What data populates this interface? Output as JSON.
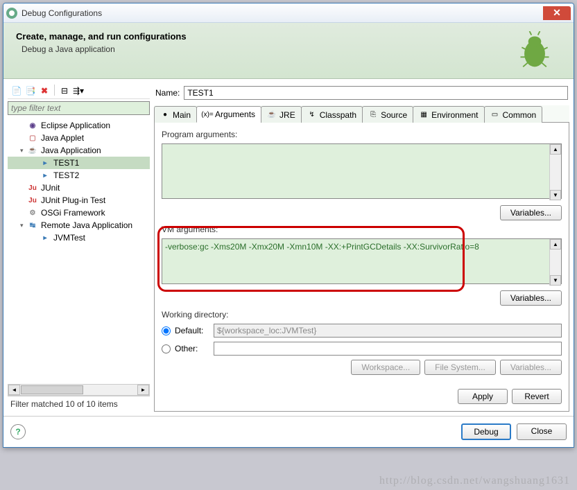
{
  "titlebar": {
    "text": "Debug Configurations"
  },
  "header": {
    "title": "Create, manage, and run configurations",
    "subtitle": "Debug a Java application"
  },
  "leftPane": {
    "filterPlaceholder": "type filter text",
    "tree": [
      {
        "label": "Eclipse Application",
        "icon": "eclipse",
        "indent": 1
      },
      {
        "label": "Java Applet",
        "icon": "applet",
        "indent": 1
      },
      {
        "label": "Java Application",
        "icon": "java-app",
        "indent": 1,
        "caret": "▾"
      },
      {
        "label": "TEST1",
        "icon": "java-run",
        "indent": 2,
        "selected": true
      },
      {
        "label": "TEST2",
        "icon": "java-run",
        "indent": 2
      },
      {
        "label": "JUnit",
        "icon": "junit",
        "indent": 1
      },
      {
        "label": "JUnit Plug-in Test",
        "icon": "junit-plug",
        "indent": 1
      },
      {
        "label": "OSGi Framework",
        "icon": "osgi",
        "indent": 1
      },
      {
        "label": "Remote Java Application",
        "icon": "remote",
        "indent": 1,
        "caret": "▾"
      },
      {
        "label": "JVMTest",
        "icon": "java-run",
        "indent": 2
      }
    ],
    "filterStatus": "Filter matched 10 of 10 items"
  },
  "rightPane": {
    "nameLabel": "Name:",
    "nameValue": "TEST1",
    "tabs": [
      {
        "label": "Main",
        "icon": "●"
      },
      {
        "label": "Arguments",
        "icon": "(x)=",
        "active": true
      },
      {
        "label": "JRE",
        "icon": "☕"
      },
      {
        "label": "Classpath",
        "icon": "↯"
      },
      {
        "label": "Source",
        "icon": "⎘"
      },
      {
        "label": "Environment",
        "icon": "▦"
      },
      {
        "label": "Common",
        "icon": "▭"
      }
    ],
    "programArgs": {
      "label": "Program arguments:",
      "value": "",
      "button": "Variables..."
    },
    "vmArgs": {
      "label": "VM arguments:",
      "value": "-verbose:gc -Xms20M -Xmx20M -Xmn10M -XX:+PrintGCDetails -XX:SurvivorRatio=8",
      "button": "Variables..."
    },
    "workdir": {
      "label": "Working directory:",
      "defaultLabel": "Default:",
      "defaultValue": "${workspace_loc:JVMTest}",
      "otherLabel": "Other:",
      "buttons": [
        "Workspace...",
        "File System...",
        "Variables..."
      ]
    },
    "applyBtn": "Apply",
    "revertBtn": "Revert"
  },
  "footer": {
    "debug": "Debug",
    "close": "Close"
  },
  "watermark": "http://blog.csdn.net/wangshuang1631"
}
